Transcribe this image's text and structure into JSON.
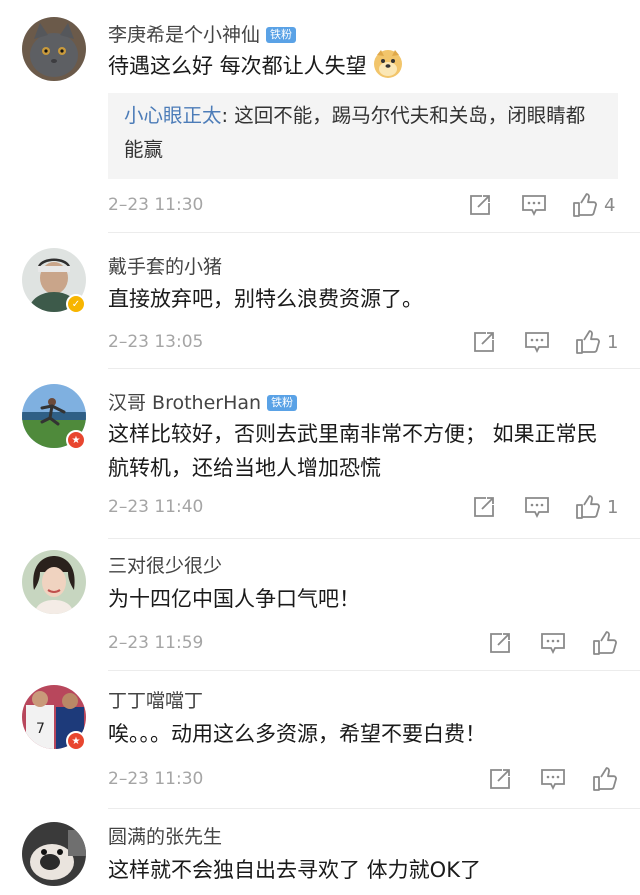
{
  "comments": [
    {
      "username": "李庚希是个小神仙",
      "badge": "铁粉",
      "text": "待遇这么好  每次都让人失望",
      "emoji": "doge-emoji",
      "reply": {
        "user": "小心眼正太",
        "text": ": 这回不能，踢马尔代夫和关岛，闭眼睛都能赢"
      },
      "time": "2–23 11:30",
      "likes": "4"
    },
    {
      "username": "戴手套的小猪",
      "text": "直接放弃吧，别特么浪费资源了。",
      "time": "2–23 13:05",
      "likes": "1"
    },
    {
      "username": "汉哥 BrotherHan",
      "badge": "铁粉",
      "text": "这样比较好，否则去武里南非常不方便； 如果正常民航转机，还给当地人增加恐慌",
      "time": "2–23 11:40",
      "likes": "1"
    },
    {
      "username": "三对很少很少",
      "text": "为十四亿中国人争口气吧！",
      "time": "2–23 11:59",
      "likes": ""
    },
    {
      "username": "丁丁噹噹丁",
      "text": "唉。。。动用这么多资源，希望不要白费！",
      "time": "2–23 11:30",
      "likes": ""
    },
    {
      "username": "圆满的张先生",
      "text": "这样就不会独自出去寻欢了 体力就OK了"
    }
  ],
  "colors": {
    "link": "#4c7cb8",
    "fan_badge": "#5aa2e6",
    "time": "#a5a5a5",
    "verified_gold": "#f7b500",
    "verified_red": "#e8462f"
  },
  "icons": {
    "share": "share-icon",
    "reply": "comment-icon",
    "like": "thumbs-up-icon"
  }
}
